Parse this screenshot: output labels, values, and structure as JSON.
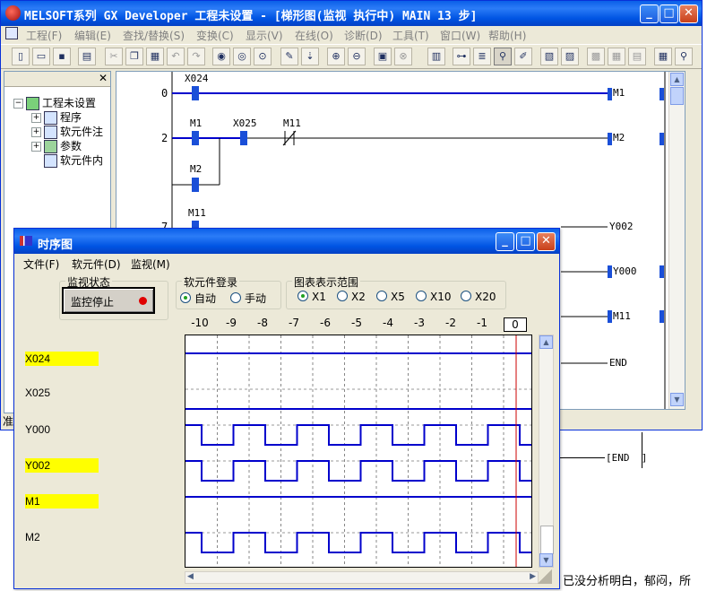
{
  "main_window": {
    "title": "MELSOFT系列 GX Developer 工程未设置 - [梯形图(监视 执行中)    MAIN    13 步]",
    "menu": [
      "工程(F)",
      "编辑(E)",
      "查找/替换(S)",
      "变换(C)",
      "显示(V)",
      "在线(O)",
      "诊断(D)",
      "工具(T)",
      "窗口(W)",
      "帮助(H)"
    ],
    "tree": {
      "root": "工程未设置",
      "items": [
        "程序",
        "软元件注",
        "参数",
        "软元件内"
      ]
    },
    "status_fragment": "准"
  },
  "ladder": {
    "step_numbers": [
      "0",
      "2",
      "7"
    ],
    "contacts": [
      "X024",
      "M1",
      "X025",
      "M11",
      "M2",
      "M11"
    ],
    "coils": [
      "M1",
      "M2",
      "Y002",
      "Y000",
      "M11",
      "END"
    ],
    "outer_end": "END"
  },
  "timing_window": {
    "title": "时序图",
    "menu": [
      "文件(F)",
      "软元件(D)",
      "监视(M)"
    ],
    "monitor_group_label": "监视状态",
    "monitor_button": "监控停止",
    "register_group_label": "软元件登录",
    "register_options": [
      "自动",
      "手动"
    ],
    "register_selected": 0,
    "range_group_label": "图表表示范围",
    "range_options": [
      "X1",
      "X2",
      "X5",
      "X10",
      "X20"
    ],
    "range_selected": 0,
    "tick_labels": [
      "-10",
      "-9",
      "-8",
      "-7",
      "-6",
      "-5",
      "-4",
      "-3",
      "-2",
      "-1",
      "0"
    ],
    "devices": [
      {
        "name": "X024",
        "highlight": true,
        "kind": "bit",
        "pattern": "high"
      },
      {
        "name": "X025",
        "highlight": false,
        "kind": "bit",
        "pattern": "low"
      },
      {
        "name": "Y000",
        "highlight": false,
        "kind": "bit",
        "pattern": "square"
      },
      {
        "name": "Y002",
        "highlight": true,
        "kind": "bit",
        "pattern": "square"
      },
      {
        "name": "M1",
        "highlight": true,
        "kind": "bit",
        "pattern": "high"
      },
      {
        "name": "M2",
        "highlight": false,
        "kind": "bit",
        "pattern": "square"
      }
    ],
    "colors": {
      "signal": "#0000cc",
      "cursor": "#cc0000",
      "highlight": "#ffff00"
    }
  },
  "background_text": "已没分析明白，郁闷，所"
}
